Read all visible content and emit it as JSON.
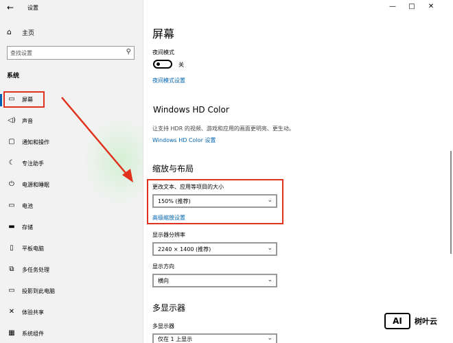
{
  "window": {
    "title": "设置",
    "controls": [
      "—",
      "□",
      "✕"
    ]
  },
  "sidebar": {
    "home_label": "主页",
    "search_placeholder": "查找设置",
    "section": "系统",
    "items": [
      {
        "label": "屏幕",
        "icon": "monitor-icon",
        "selected": true
      },
      {
        "label": "声音",
        "icon": "speaker-icon"
      },
      {
        "label": "通知和操作",
        "icon": "notification-icon"
      },
      {
        "label": "专注助手",
        "icon": "moon-icon"
      },
      {
        "label": "电源和睡眠",
        "icon": "power-icon"
      },
      {
        "label": "电池",
        "icon": "battery-icon"
      },
      {
        "label": "存储",
        "icon": "storage-icon"
      },
      {
        "label": "平板电脑",
        "icon": "tablet-icon"
      },
      {
        "label": "多任务处理",
        "icon": "multitask-icon"
      },
      {
        "label": "投影到此电脑",
        "icon": "projector-icon"
      },
      {
        "label": "体验共享",
        "icon": "share-icon"
      },
      {
        "label": "系统组件",
        "icon": "components-icon"
      }
    ]
  },
  "main": {
    "title": "屏幕",
    "night_mode": {
      "label": "夜间模式",
      "state": "关",
      "link": "夜间模式设置"
    },
    "hdr": {
      "heading": "Windows HD Color",
      "desc": "让支持 HDR 的视频、游戏和应用的画面更明亮、更生动。",
      "link": "Windows HD Color 设置"
    },
    "scale": {
      "heading": "缩放与布局",
      "size_label": "更改文本、应用等项目的大小",
      "size_value": "150% (推荐)",
      "advanced_link": "高级缩放设置",
      "resolution_label": "显示器分辨率",
      "resolution_value": "2240 × 1400 (推荐)",
      "orientation_label": "显示方向",
      "orientation_value": "横向"
    },
    "multi": {
      "heading": "多显示器",
      "label": "多显示器",
      "value": "仅在 1 上显示"
    }
  },
  "watermark": {
    "logo": "AI",
    "text": "树叶云"
  },
  "colors": {
    "accent": "#0063b1",
    "annotation": "#e0321c",
    "sidebar_bg": "#f2f2f2"
  }
}
